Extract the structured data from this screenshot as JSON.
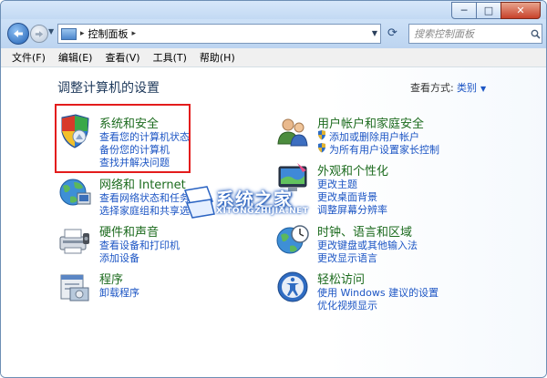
{
  "window": {
    "controls": {
      "minimize": "─",
      "maximize": "□",
      "close": "✕"
    }
  },
  "navbar": {
    "address": {
      "separator": "▸",
      "crumb": "控制面板",
      "separator2": "▸"
    },
    "search": {
      "placeholder": "搜索控制面板"
    }
  },
  "menubar": {
    "items": [
      "文件(F)",
      "编辑(E)",
      "查看(V)",
      "工具(T)",
      "帮助(H)"
    ]
  },
  "main": {
    "heading": "调整计算机的设置",
    "view_by_label": "查看方式:",
    "view_by_value": "类别"
  },
  "categories": [
    {
      "title": "系统和安全",
      "links": [
        "查看您的计算机状态",
        "备份您的计算机",
        "查找并解决问题"
      ],
      "icon": "system-security-icon"
    },
    {
      "title": "网络和 Internet",
      "links": [
        "查看网络状态和任务",
        "选择家庭组和共享选项"
      ],
      "icon": "network-internet-icon"
    },
    {
      "title": "硬件和声音",
      "links": [
        "查看设备和打印机",
        "添加设备"
      ],
      "icon": "hardware-sound-icon"
    },
    {
      "title": "程序",
      "links": [
        "卸载程序"
      ],
      "icon": "programs-icon"
    },
    {
      "title": "用户帐户和家庭安全",
      "links": [
        "添加或删除用户帐户",
        "为所有用户设置家长控制"
      ],
      "icon": "user-accounts-icon"
    },
    {
      "title": "外观和个性化",
      "links": [
        "更改主题",
        "更改桌面背景",
        "调整屏幕分辨率"
      ],
      "icon": "appearance-icon"
    },
    {
      "title": "时钟、语言和区域",
      "links": [
        "更改键盘或其他输入法",
        "更改显示语言"
      ],
      "icon": "clock-language-icon"
    },
    {
      "title": "轻松访问",
      "links": [
        "使用 Windows 建议的设置",
        "优化视频显示"
      ],
      "icon": "ease-of-access-icon"
    }
  ],
  "watermark": {
    "text": "系统之家",
    "subtext": "XITONGZHIJIA.NET"
  },
  "colors": {
    "link": "#1c55c4",
    "category_title": "#1c6b1e",
    "highlight": "#e31c1c"
  }
}
